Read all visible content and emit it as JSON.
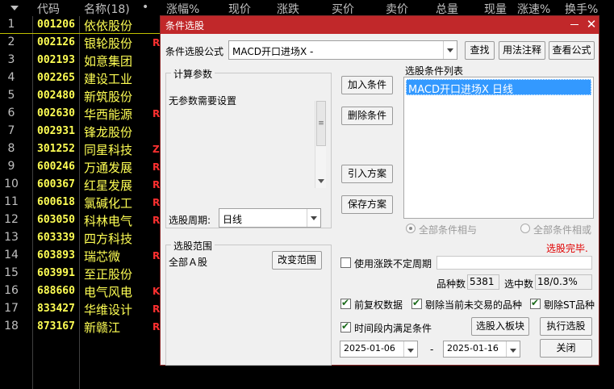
{
  "list_header": {
    "code": "代码",
    "name": "名称(18)",
    "dot": "•",
    "change_pct": "涨幅%",
    "price": "现价",
    "change": "涨跌",
    "bid": "买价",
    "ask": "卖价",
    "volume": "总量",
    "cur_volume": "现量",
    "speed": "涨速%",
    "turnover": "换手%"
  },
  "stocks": [
    {
      "no": "1",
      "code": "001206",
      "name": "依依股份",
      "flag": ""
    },
    {
      "no": "2",
      "code": "002126",
      "name": "银轮股份",
      "flag": "R"
    },
    {
      "no": "3",
      "code": "002193",
      "name": "如意集团",
      "flag": ""
    },
    {
      "no": "4",
      "code": "002265",
      "name": "建设工业",
      "flag": ""
    },
    {
      "no": "5",
      "code": "002480",
      "name": "新筑股份",
      "flag": ""
    },
    {
      "no": "6",
      "code": "002630",
      "name": "华西能源",
      "flag": "R"
    },
    {
      "no": "7",
      "code": "002931",
      "name": "锋龙股份",
      "flag": ""
    },
    {
      "no": "8",
      "code": "301252",
      "name": "同星科技",
      "flag": "Z"
    },
    {
      "no": "9",
      "code": "600246",
      "name": "万通发展",
      "flag": "R"
    },
    {
      "no": "10",
      "code": "600367",
      "name": "红星发展",
      "flag": "R"
    },
    {
      "no": "11",
      "code": "600618",
      "name": "氯碱化工",
      "flag": "R"
    },
    {
      "no": "12",
      "code": "603050",
      "name": "科林电气",
      "flag": "R"
    },
    {
      "no": "13",
      "code": "603339",
      "name": "四方科技",
      "flag": ""
    },
    {
      "no": "14",
      "code": "603893",
      "name": "瑞芯微",
      "flag": "R"
    },
    {
      "no": "15",
      "code": "603991",
      "name": "至正股份",
      "flag": ""
    },
    {
      "no": "16",
      "code": "688660",
      "name": "电气风电",
      "flag": "K"
    },
    {
      "no": "17",
      "code": "833427",
      "name": "华维设计",
      "flag": "R"
    },
    {
      "no": "18",
      "code": "873167",
      "name": "新赣江",
      "flag": "R"
    }
  ],
  "dialog": {
    "title": "条件选股",
    "close_glyph": "✕",
    "formula_label": "条件选股公式",
    "formula_value": "MACD开口进场X -",
    "find_btn": "查找",
    "usage_btn": "用法注释",
    "view_formula_btn": "查看公式",
    "params_group": "计算参数",
    "params_text": "无参数需要设置",
    "period_label": "选股周期:",
    "period_value": "日线",
    "add_btn": "加入条件",
    "delete_btn": "删除条件",
    "import_btn": "引入方案",
    "save_btn": "保存方案",
    "cond_list_label": "选股条件列表",
    "conditions": [
      "MACD开口进场X  日线"
    ],
    "radio_and": "全部条件相与",
    "radio_or": "全部条件相或",
    "status": "选股完毕.",
    "range_group": "选股范围",
    "range_value": "全部Ａ股",
    "change_range_btn": "改变范围",
    "use_period_label": "使用涨跌不定周期",
    "total_label": "品种数",
    "total_value": "5381",
    "selected_label": "选中数",
    "selected_value": "18/0.3%",
    "pre_adjust_label": "前复权数据",
    "exclude_untraded_label": "剔除当前未交易的品种",
    "exclude_st_label": "剔除ST品种",
    "time_range_label": "时间段内满足条件",
    "add_to_board_btn": "选股入板块",
    "execute_btn": "执行选股",
    "start_date": "2025-01-06",
    "date_sep": "-",
    "end_date": "2025-01-16",
    "close_btn": "关闭"
  }
}
